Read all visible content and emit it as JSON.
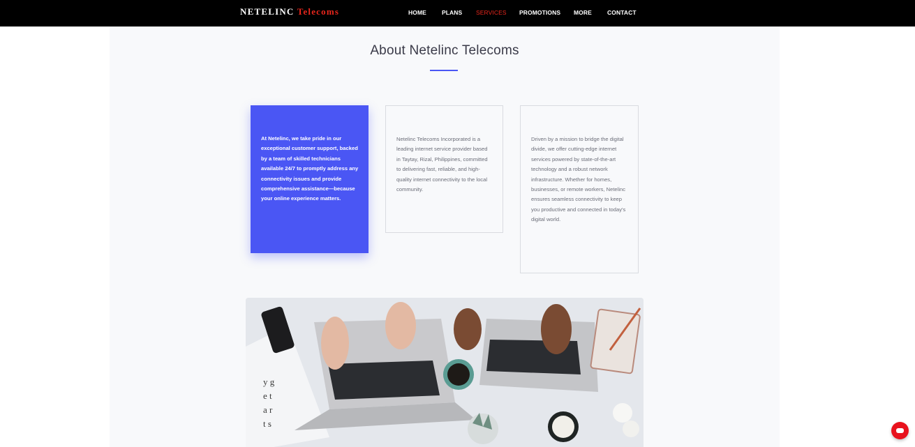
{
  "nav": {
    "brand_main": "NETELINC",
    "brand_accent": "Telecoms",
    "links": [
      "HOME",
      "PLANS",
      "SERVICES",
      "PROMOTIONS",
      "MORE",
      "CONTACT"
    ],
    "active_link": "SERVICES"
  },
  "about": {
    "title": "About Netelinc Telecoms",
    "cards": [
      "At Netelinc, we take pride in our exceptional customer support, backed by a team of skilled technicians available 24/7 to promptly address any connectivity issues and provide comprehensive assistance—because your online experience matters.",
      "Netelinc Telecoms Incorporated is a leading internet service provider based in Taytay, Rizal, Philippines, committed to delivering fast, reliable, and high-quality internet connectivity to the local community.",
      "Driven by a mission to bridge the digital divide, we offer cutting-edge internet services powered by state-of-the-art technology and a robust network infrastructure. Whether for homes, businesses, or remote workers, Netelinc ensures seamless connectivity to keep you productive and connected in today's digital world."
    ]
  },
  "colors": {
    "accent_blue": "#4a56f4",
    "brand_red": "#e8261c",
    "nav_bg": "#000000"
  },
  "icons": {
    "chat": "chat-bubble-icon"
  }
}
